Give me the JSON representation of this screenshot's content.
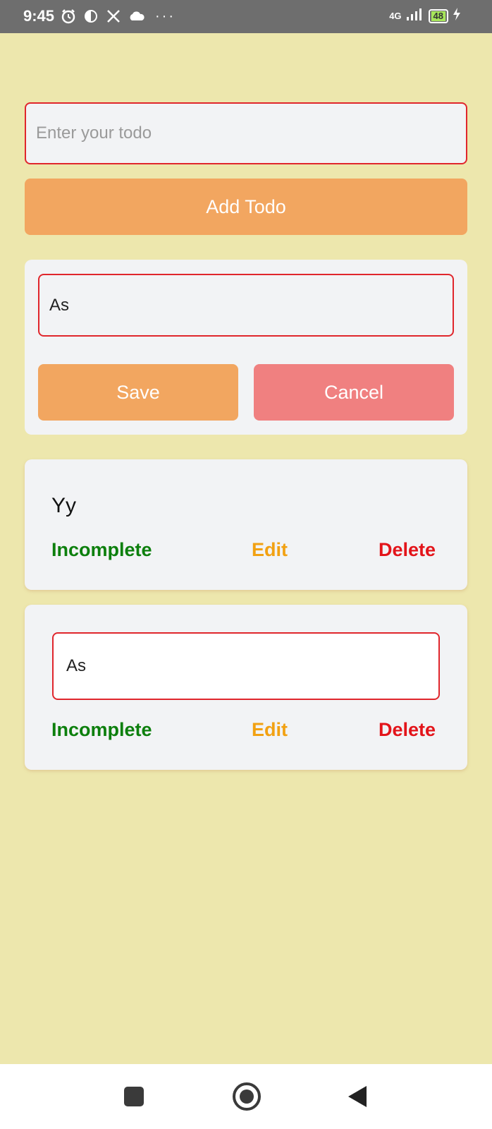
{
  "status_bar": {
    "time": "9:45",
    "network": "4G",
    "battery": "48",
    "icons": [
      "alarm-icon",
      "app-icon",
      "x-icon",
      "cloud-icon",
      "more-icon",
      "signal-icon",
      "battery-icon",
      "charging-icon"
    ]
  },
  "new_todo": {
    "placeholder": "Enter your todo",
    "add_label": "Add Todo"
  },
  "edit_panel": {
    "value": "As",
    "save_label": "Save",
    "cancel_label": "Cancel"
  },
  "todos": [
    {
      "text": "Yy",
      "status": "Incomplete",
      "edit": "Edit",
      "delete": "Delete"
    },
    {
      "edit_value": "As",
      "status": "Incomplete",
      "edit": "Edit",
      "delete": "Delete"
    }
  ],
  "nav": {
    "icons": [
      "recents-square-icon",
      "home-circle-icon",
      "back-triangle-icon"
    ]
  },
  "colors": {
    "background": "#ede7ad",
    "accent_orange": "#f2a660",
    "cancel_red": "#f08080",
    "border_red": "#e0262c",
    "incomplete_green": "#0d7f0d",
    "edit_amber": "#f2a112",
    "delete_red": "#e3141a"
  }
}
